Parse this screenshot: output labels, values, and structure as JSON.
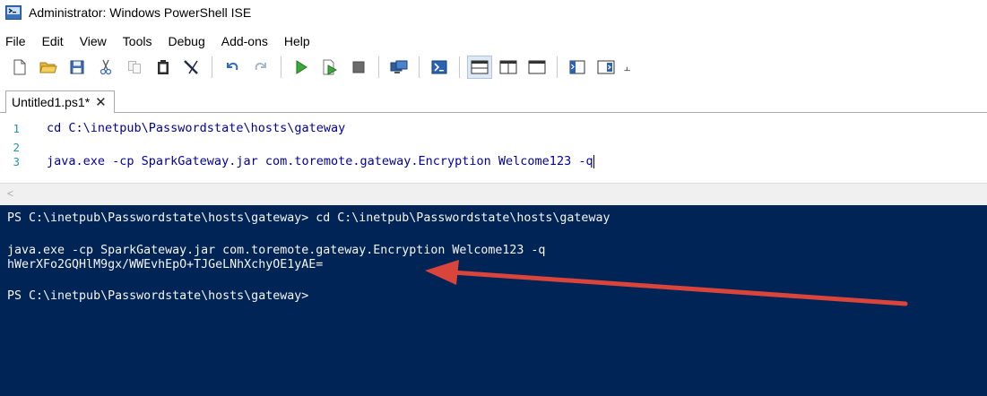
{
  "window": {
    "title": "Administrator: Windows PowerShell ISE"
  },
  "menu": [
    "File",
    "Edit",
    "View",
    "Tools",
    "Debug",
    "Add-ons",
    "Help"
  ],
  "tab": {
    "label": "Untitled1.ps1*",
    "close": "✕"
  },
  "editor": {
    "lines": [
      {
        "no": "1",
        "text": "cd C:\\inetpub\\Passwordstate\\hosts\\gateway"
      },
      {
        "no": "2",
        "text": ""
      },
      {
        "no": "3",
        "text": "java.exe -cp SparkGateway.jar com.toremote.gateway.Encryption Welcome123 -q"
      }
    ]
  },
  "scrollbar": {
    "left_arrow": "<"
  },
  "console": {
    "lines": [
      "PS C:\\inetpub\\Passwordstate\\hosts\\gateway> cd C:\\inetpub\\Passwordstate\\hosts\\gateway",
      "java.exe -cp SparkGateway.jar com.toremote.gateway.Encryption Welcome123 -q",
      "hWerXFo2GQHlM9gx/WWEvhEpO+TJGeLNhXchyOE1yAE=",
      "PS C:\\inetpub\\Passwordstate\\hosts\\gateway>"
    ]
  },
  "colors": {
    "console_bg": "#012456",
    "console_fg": "#f5f5f5",
    "code_fg": "#00009c",
    "line_number": "#2b91af",
    "arrow": "#d9443b"
  },
  "toolbar_icons": [
    "new-file-icon",
    "open-folder-icon",
    "save-icon",
    "cut-icon",
    "copy-icon",
    "paste-icon",
    "clear-console-icon",
    "undo-icon",
    "redo-icon",
    "run-script-icon",
    "run-selection-icon",
    "stop-icon",
    "remote-powershell-icon",
    "start-powershell-icon",
    "show-script-pane-top-icon",
    "show-script-pane-right-icon",
    "show-script-pane-maximized-icon",
    "show-command-window-icon",
    "show-command-addon-icon"
  ]
}
